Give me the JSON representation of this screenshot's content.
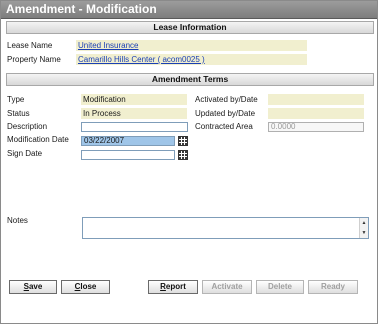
{
  "window": {
    "title": "Amendment - Modification"
  },
  "lease_section": {
    "header": "Lease Information",
    "lease_name_label": "Lease Name",
    "lease_name_value": "United Insurance",
    "property_name_label": "Property Name",
    "property_name_value": "Camarillo Hills Center ( acom0025 )"
  },
  "terms_section": {
    "header": "Amendment Terms",
    "type_label": "Type",
    "type_value": "Modification",
    "status_label": "Status",
    "status_value": "In Process",
    "description_label": "Description",
    "description_value": "",
    "mod_date_label": "Modification Date",
    "mod_date_value": "03/22/2007",
    "sign_date_label": "Sign Date",
    "sign_date_value": "",
    "activated_label": "Activated by/Date",
    "activated_value": "",
    "updated_label": "Updated by/Date",
    "updated_value": "",
    "contracted_area_label": "Contracted Area",
    "contracted_area_value": "0.0000",
    "notes_label": "Notes",
    "notes_value": ""
  },
  "buttons": {
    "save_first": "S",
    "save_rest": "ave",
    "close_first": "C",
    "close_rest": "lose",
    "report_first": "R",
    "report_rest": "eport",
    "activate": "Activate",
    "delete": "Delete",
    "ready": "Ready"
  },
  "icons": {
    "calendar": "calendar-icon",
    "scroll_up": "scroll-up-icon",
    "scroll_down": "scroll-down-icon"
  }
}
